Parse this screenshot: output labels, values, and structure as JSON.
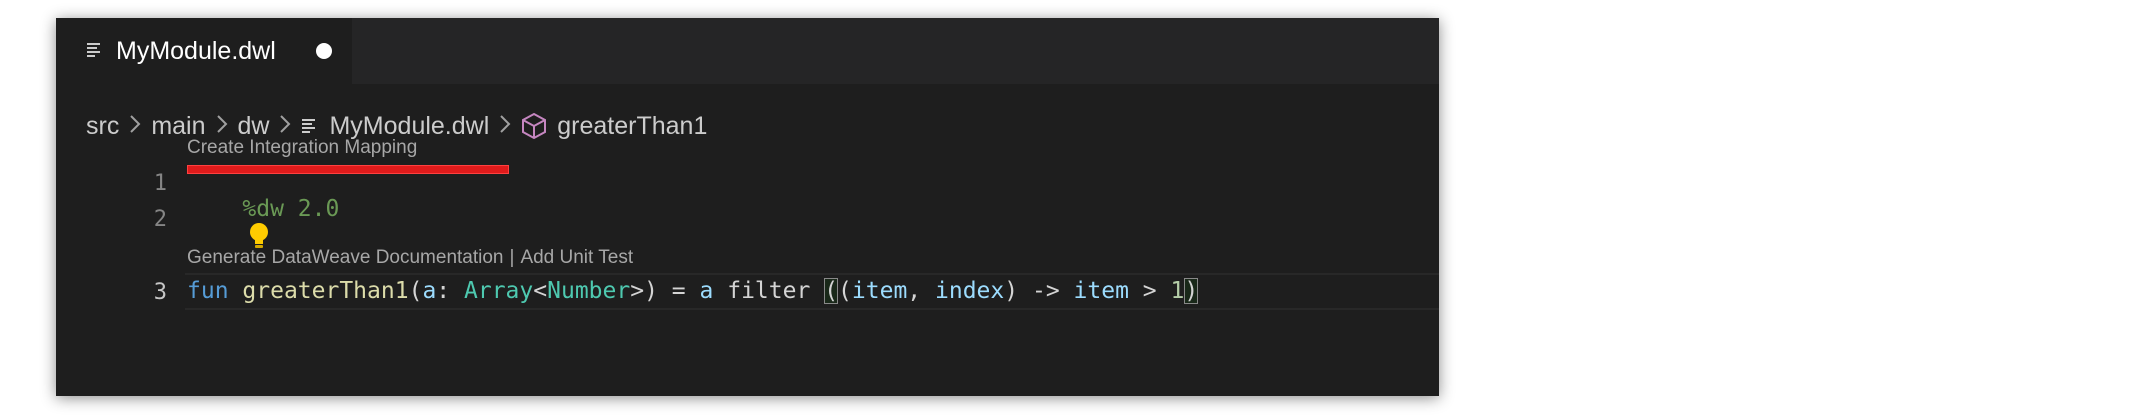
{
  "editor": {
    "tab": {
      "file_name": "MyModule.dwl",
      "file_icon": "file-lines-icon",
      "dirty": true
    },
    "breadcrumb": {
      "items": [
        "src",
        "main",
        "dw",
        "MyModule.dwl",
        "greaterThan1"
      ],
      "icons": {
        "file": "file-lines-icon",
        "symbol": "cube-icon"
      },
      "symbol_icon_color": "#c586c0"
    },
    "codelens": {
      "top": "Create Integration Mapping",
      "function_links": [
        "Generate DataWeave Documentation",
        "Add Unit Test"
      ],
      "separator": "|"
    },
    "lines": [
      {
        "number": "1",
        "text": "%dw 2.0"
      },
      {
        "number": "2",
        "text": ""
      },
      {
        "number": "3",
        "tokens": {
          "kw": "fun",
          "fn": "greaterThan1",
          "paren_open": "(",
          "param": "a",
          "colon": ":",
          "type1": "Array",
          "lt": "<",
          "type2": "Number",
          "gt": ">",
          "paren_close": ")",
          "eq": "=",
          "ref": "a",
          "op": "filter",
          "lambda_open": "(",
          "inner_open": "(",
          "arg1": "item",
          "comma": ",",
          "arg2": "index",
          "inner_close": ")",
          "arrow": "->",
          "item_ref": "item",
          "gtop": ">",
          "num": "1",
          "lambda_close": ")"
        }
      }
    ],
    "lightbulb_icon": "lightbulb-icon",
    "colors": {
      "background": "#1e1e1e",
      "tabbar": "#252526",
      "underline_highlight": "#e01b1b",
      "lightbulb": "#ffcc00"
    }
  }
}
